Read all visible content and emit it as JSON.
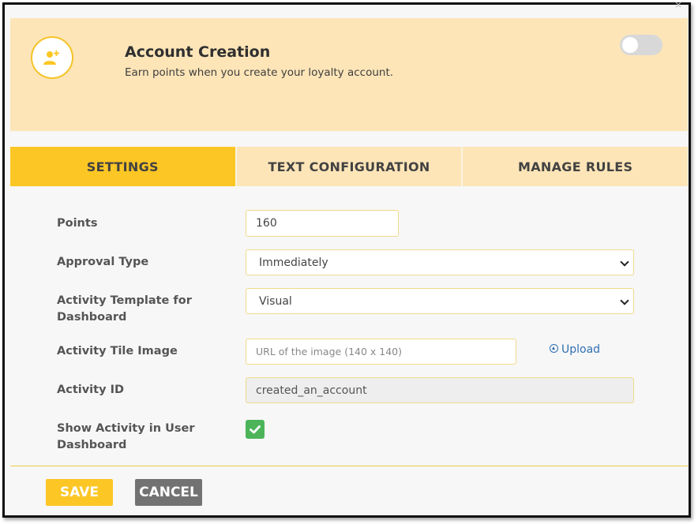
{
  "header": {
    "title": "Account Creation",
    "subtitle": "Earn points when you create your loyalty account.",
    "icon": "add-user-icon",
    "toggle_enabled": false,
    "close_symbol": "×"
  },
  "tabs": [
    {
      "label": "SETTINGS",
      "active": true
    },
    {
      "label": "TEXT CONFIGURATION",
      "active": false
    },
    {
      "label": "MANAGE RULES",
      "active": false
    }
  ],
  "form": {
    "points": {
      "label": "Points",
      "value": "160"
    },
    "approval_type": {
      "label": "Approval Type",
      "value": "Immediately"
    },
    "activity_template": {
      "label_line1": "Activity Template for",
      "label_line2": "Dashboard",
      "value": "Visual"
    },
    "tile_image": {
      "label": "Activity Tile Image",
      "placeholder": "URL of the image (140 x 140)",
      "upload_label": "Upload"
    },
    "activity_id": {
      "label": "Activity ID",
      "value": "created_an_account"
    },
    "show_in_dashboard": {
      "label_line1": "Show Activity in User",
      "label_line2": "Dashboard",
      "checked": true
    }
  },
  "footer": {
    "save_label": "SAVE",
    "cancel_label": "CANCEL"
  },
  "colors": {
    "accent": "#fcc624",
    "header_bg": "#fde5b8",
    "link": "#2f6fb2",
    "checkbox": "#4db45a",
    "cancel": "#727272"
  }
}
